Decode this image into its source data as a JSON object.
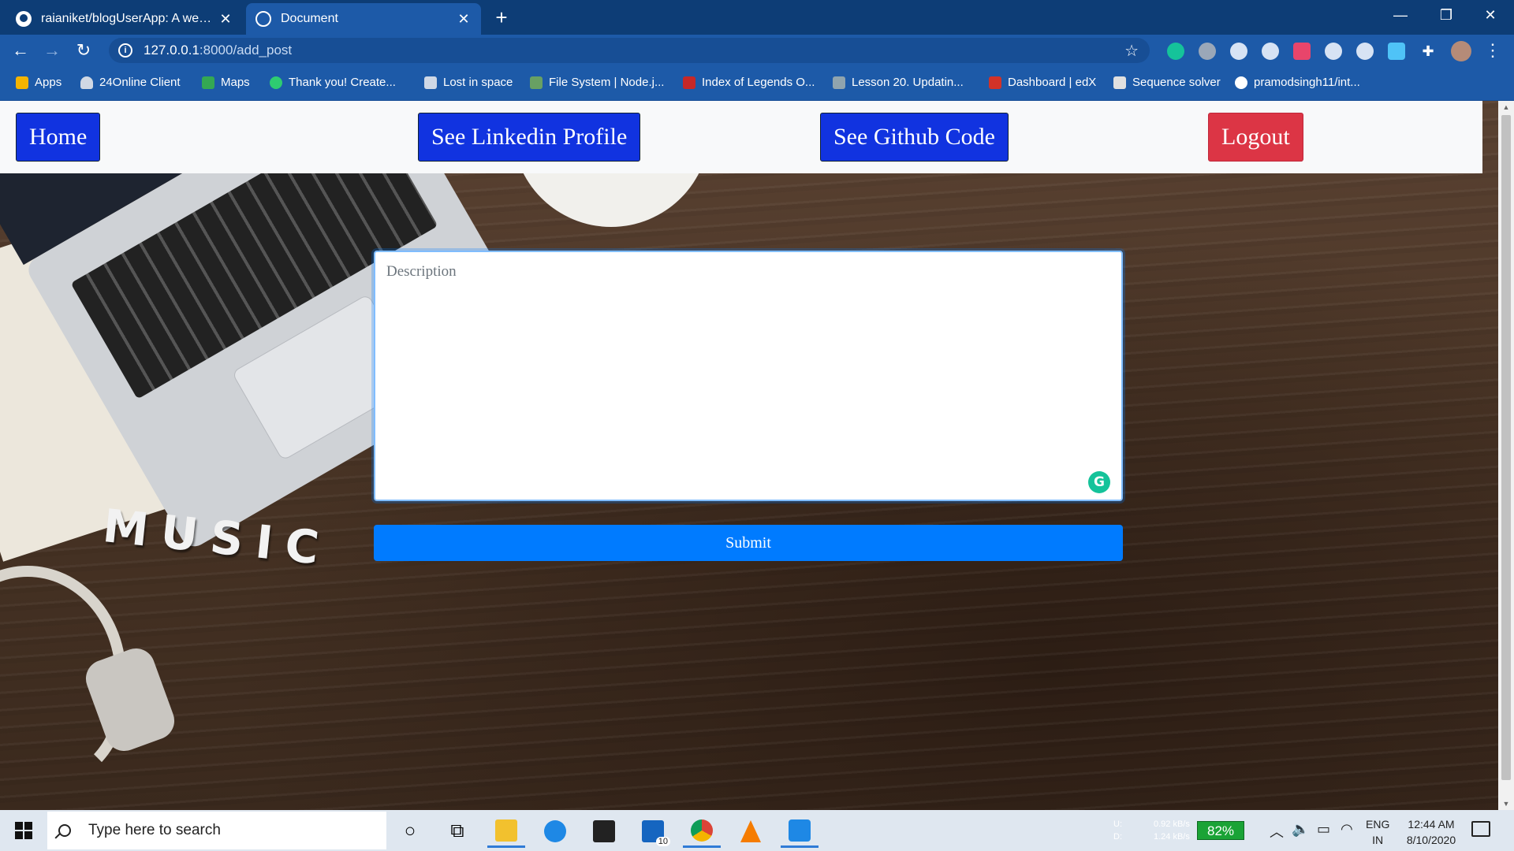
{
  "browser": {
    "tabs": [
      {
        "title": "raianiket/blogUserApp: A web ap",
        "icon": "github-icon",
        "active": false
      },
      {
        "title": "Document",
        "icon": "globe-icon",
        "active": true
      }
    ],
    "url_host": "127.0.0.1",
    "url_path": ":8000/add_post",
    "bookmarks": [
      {
        "label": "Apps",
        "icon": "apps-grid-icon",
        "color": "#f4b400"
      },
      {
        "label": "24Online Client",
        "icon": "cloud-icon",
        "color": "#d0d8e4"
      },
      {
        "label": "Maps",
        "icon": "maps-icon",
        "color": "#34a853"
      },
      {
        "label": "Thank you! Create...",
        "icon": "recycle-icon",
        "color": "#2ecc71"
      },
      {
        "label": "Lost in space",
        "icon": "k-icon",
        "color": "#cfd8e6"
      },
      {
        "label": "File System | Node.j...",
        "icon": "nodejs-icon",
        "color": "#68a063"
      },
      {
        "label": "Index of Legends O...",
        "icon": "flag-icon",
        "color": "#c62828"
      },
      {
        "label": "Lesson 20. Updatin...",
        "icon": "lesson-icon",
        "color": "#90a4ae"
      },
      {
        "label": "Dashboard | edX",
        "icon": "edx-icon",
        "color": "#d23228"
      },
      {
        "label": "Sequence solver",
        "icon": "rq-icon",
        "color": "#e0e0e0"
      },
      {
        "label": "pramodsingh11/int...",
        "icon": "github-icon",
        "color": "#ffffff"
      }
    ]
  },
  "nav": {
    "home": "Home",
    "linkedin": "See Linkedin Profile",
    "github": "See Github Code",
    "logout": "Logout"
  },
  "form": {
    "description_placeholder": "Description",
    "description_value": "",
    "submit": "Submit"
  },
  "background": {
    "word": "MUSIC"
  },
  "taskbar": {
    "search_placeholder": "Type here to search",
    "net_up_label": "U:",
    "net_down_label": "D:",
    "net_up": "0.92 kB/s",
    "net_down": "1.24 kB/s",
    "battery": "82%",
    "lang_line1": "ENG",
    "lang_line2": "IN",
    "time": "12:44 AM",
    "date": "8/10/2020",
    "mail_badge": "10"
  },
  "colors": {
    "nav_blue": "#1133e0",
    "logout_red": "#dc3545",
    "submit_blue": "#007bff",
    "chrome_frame": "#0d3d76"
  }
}
